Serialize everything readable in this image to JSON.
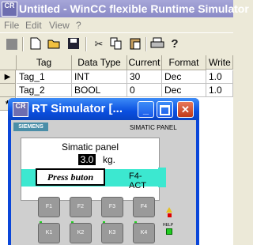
{
  "window": {
    "title": "Untitled - WinCC flexible Runtime Simulator",
    "icon_text": "CR"
  },
  "menu": [
    "File",
    "Edit",
    "View",
    "?"
  ],
  "toolbar_icons": [
    "stop-icon",
    "new-icon",
    "open-icon",
    "save-icon",
    "cut-icon",
    "copy-icon",
    "paste-icon",
    "print-icon",
    "help-icon"
  ],
  "table": {
    "columns": [
      "Tag",
      "Data Type",
      "Current",
      "Format",
      "Write"
    ],
    "rows": [
      {
        "marker": "▶",
        "tag": "Tag_1",
        "type": "INT",
        "current": "30",
        "format": "Dec",
        "write": "1.0"
      },
      {
        "marker": "",
        "tag": "Tag_2",
        "type": "BOOL",
        "current": "0",
        "format": "Dec",
        "write": "1.0"
      }
    ],
    "new_row_marker": "*"
  },
  "simulator": {
    "title": "RT Simulator [...",
    "brand": "SIEMENS",
    "model": "SIMATIC PANEL",
    "screen": {
      "heading": "Simatic panel",
      "value": "3.0",
      "unit": "kg.",
      "button": "Press buton",
      "f4_label": "F4-ACT"
    },
    "fkeys": [
      "F1",
      "F2",
      "F3",
      "F4"
    ],
    "kkeys": [
      "K1",
      "K2",
      "K3",
      "K4"
    ],
    "help_label": "HELP"
  }
}
